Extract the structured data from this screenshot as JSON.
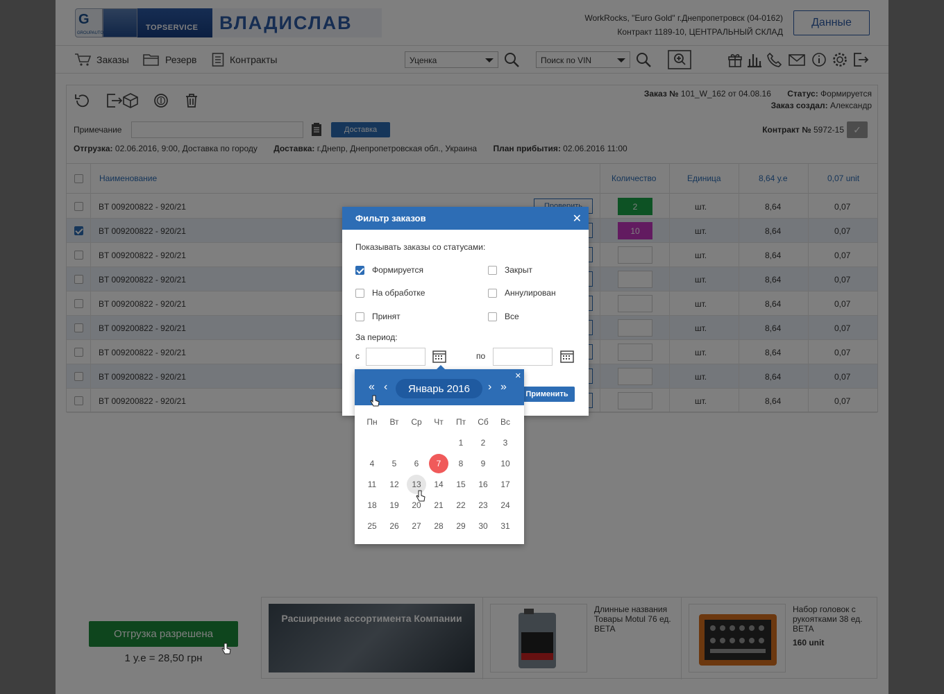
{
  "header": {
    "logo_group": "G",
    "logo_group_sub": "GROUPAUTO",
    "logo_topservice": "TOPSERVICE",
    "logo_name": "ВЛАДИСЛАВ",
    "info_line1": "WorkRocks, \"Euro Gold\" г.Днепропетровск (04-0162)",
    "info_line2": "Контракт 1189-10, ЦЕНТРАЛЬНЫЙ СКЛАД",
    "data_button": "Данные"
  },
  "nav": {
    "orders": "Заказы",
    "reserve": "Резерв",
    "contracts": "Контракты",
    "select1": "Уценка",
    "select2": "Поиск по VIN"
  },
  "order": {
    "number_label": "Заказ №",
    "number_value": "101_W_162 от 04.08.16",
    "status_label": "Статус:",
    "status_value": "Формируется",
    "creator_label": "Заказ создал:",
    "creator_value": "Александр",
    "note_label": "Примечание",
    "delivery_button": "Доставка",
    "contract_label": "Контракт №",
    "contract_value": "5972-15",
    "ship_label": "Отгрузка:",
    "ship_value": "02.06.2016, 9:00, Доставка по городу",
    "deliv_label": "Доставка:",
    "deliv_value": "г.Днепр, Днепропетровская обл., Украина",
    "arrival_label": "План прибытия:",
    "arrival_value": "02.06.2016 11:00"
  },
  "table": {
    "headers": {
      "name": "Наименование",
      "qty": "Количество",
      "unit": "Единица",
      "p1": "8,64 у.е",
      "p2": "0,07 unit"
    },
    "check_label": "Проверить",
    "rows": [
      {
        "name": "BT 009200822 - 920/21",
        "qty": "2",
        "qty_color": "#1aa548",
        "unit": "шт.",
        "p1": "8,64",
        "p2": "0,07",
        "checked": false
      },
      {
        "name": "BT 009200822 - 920/21",
        "qty": "10",
        "qty_color": "#c437c0",
        "unit": "шт.",
        "p1": "8,64",
        "p2": "0,07",
        "checked": true
      },
      {
        "name": "BT 009200822 - 920/21",
        "qty": "",
        "qty_color": "",
        "unit": "шт.",
        "p1": "8,64",
        "p2": "0,07",
        "checked": false
      },
      {
        "name": "BT 009200822 - 920/21",
        "qty": "",
        "qty_color": "",
        "unit": "шт.",
        "p1": "8,64",
        "p2": "0,07",
        "checked": false
      },
      {
        "name": "BT 009200822 - 920/21",
        "qty": "",
        "qty_color": "",
        "unit": "шт.",
        "p1": "8,64",
        "p2": "0,07",
        "checked": false
      },
      {
        "name": "BT 009200822 - 920/21",
        "qty": "",
        "qty_color": "",
        "unit": "шт.",
        "p1": "8,64",
        "p2": "0,07",
        "checked": false
      },
      {
        "name": "BT 009200822 - 920/21",
        "qty": "",
        "qty_color": "",
        "unit": "шт.",
        "p1": "8,64",
        "p2": "0,07",
        "checked": false
      },
      {
        "name": "BT 009200822 - 920/21",
        "qty": "",
        "qty_color": "",
        "unit": "шт.",
        "p1": "8,64",
        "p2": "0,07",
        "checked": false
      },
      {
        "name": "BT 009200822 - 920/21",
        "qty": "",
        "qty_color": "",
        "unit": "шт.",
        "p1": "8,64",
        "p2": "0,07",
        "checked": false
      }
    ]
  },
  "bottom": {
    "ship_allowed": "Отгрузка разрешена",
    "rate": "1 у.е = 28,50 грн",
    "banner_text": "Расширение ассортимента Компании",
    "promo1_text": "Длинные названия Товары Motul 76 ед. BETA",
    "promo2_text": "Набор головок с рукоятками 38 ед. BETA",
    "promo2_price": "160 unit"
  },
  "modal": {
    "title": "Фильтр заказов",
    "statuses_label": "Показывать заказы со статусами:",
    "options": [
      {
        "label": "Формируется",
        "checked": true
      },
      {
        "label": "Закрыт",
        "checked": false
      },
      {
        "label": "На обработке",
        "checked": false
      },
      {
        "label": "Аннулирован",
        "checked": false
      },
      {
        "label": "Принят",
        "checked": false
      },
      {
        "label": "Все",
        "checked": false
      }
    ],
    "period_label": "За период:",
    "from_label": "с",
    "to_label": "по",
    "from_value": "",
    "to_value": "",
    "apply_button": "Применить"
  },
  "calendar": {
    "month": "Январь 2016",
    "weekdays": [
      "Пн",
      "Вт",
      "Ср",
      "Чт",
      "Пт",
      "Сб",
      "Вс"
    ],
    "first_weekday_index": 4,
    "days_in_month": 31,
    "today": 7,
    "hover": 13
  },
  "colors": {
    "accent": "#2d6db5",
    "green": "#1d8a3b",
    "today": "#f05a5a"
  }
}
